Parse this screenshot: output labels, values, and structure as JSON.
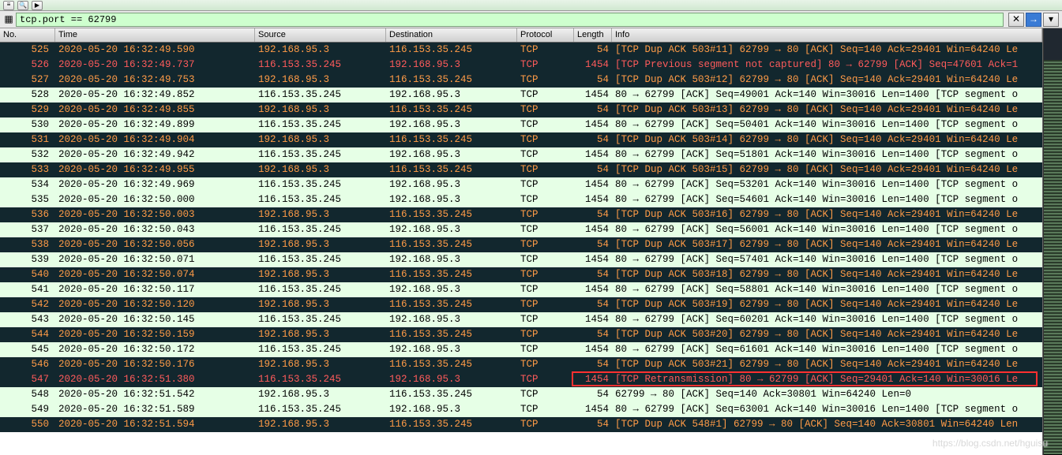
{
  "toolbar": {
    "icons": [
      "≡",
      "🔍",
      "▶"
    ]
  },
  "filter": {
    "icon": "▦",
    "value": "tcp.port == 62799",
    "btn_clear": "✕",
    "btn_apply": "→",
    "btn_dropdown": "▾"
  },
  "columns": {
    "no": "No.",
    "time": "Time",
    "source": "Source",
    "destination": "Destination",
    "protocol": "Protocol",
    "length": "Length",
    "info": "Info"
  },
  "packets": [
    {
      "no": "525",
      "time": "2020-05-20 16:32:49.590",
      "src": "192.168.95.3",
      "dst": "116.153.35.245",
      "proto": "TCP",
      "len": "54",
      "info": "[TCP Dup ACK 503#11] 62799 → 80 [ACK] Seq=140 Ack=29401 Win=64240 Le",
      "cls": "dupack"
    },
    {
      "no": "526",
      "time": "2020-05-20 16:32:49.737",
      "src": "116.153.35.245",
      "dst": "192.168.95.3",
      "proto": "TCP",
      "len": "1454",
      "info": "[TCP Previous segment not captured] 80 → 62799 [ACK] Seq=47601 Ack=1",
      "cls": "notcap"
    },
    {
      "no": "527",
      "time": "2020-05-20 16:32:49.753",
      "src": "192.168.95.3",
      "dst": "116.153.35.245",
      "proto": "TCP",
      "len": "54",
      "info": "[TCP Dup ACK 503#12] 62799 → 80 [ACK] Seq=140 Ack=29401 Win=64240 Le",
      "cls": "dupack"
    },
    {
      "no": "528",
      "time": "2020-05-20 16:32:49.852",
      "src": "116.153.35.245",
      "dst": "192.168.95.3",
      "proto": "TCP",
      "len": "1454",
      "info": "80 → 62799 [ACK] Seq=49001 Ack=140 Win=30016 Len=1400 [TCP segment o",
      "cls": "normal"
    },
    {
      "no": "529",
      "time": "2020-05-20 16:32:49.855",
      "src": "192.168.95.3",
      "dst": "116.153.35.245",
      "proto": "TCP",
      "len": "54",
      "info": "[TCP Dup ACK 503#13] 62799 → 80 [ACK] Seq=140 Ack=29401 Win=64240 Le",
      "cls": "dupack"
    },
    {
      "no": "530",
      "time": "2020-05-20 16:32:49.899",
      "src": "116.153.35.245",
      "dst": "192.168.95.3",
      "proto": "TCP",
      "len": "1454",
      "info": "80 → 62799 [ACK] Seq=50401 Ack=140 Win=30016 Len=1400 [TCP segment o",
      "cls": "normal"
    },
    {
      "no": "531",
      "time": "2020-05-20 16:32:49.904",
      "src": "192.168.95.3",
      "dst": "116.153.35.245",
      "proto": "TCP",
      "len": "54",
      "info": "[TCP Dup ACK 503#14] 62799 → 80 [ACK] Seq=140 Ack=29401 Win=64240 Le",
      "cls": "dupack"
    },
    {
      "no": "532",
      "time": "2020-05-20 16:32:49.942",
      "src": "116.153.35.245",
      "dst": "192.168.95.3",
      "proto": "TCP",
      "len": "1454",
      "info": "80 → 62799 [ACK] Seq=51801 Ack=140 Win=30016 Len=1400 [TCP segment o",
      "cls": "normal"
    },
    {
      "no": "533",
      "time": "2020-05-20 16:32:49.955",
      "src": "192.168.95.3",
      "dst": "116.153.35.245",
      "proto": "TCP",
      "len": "54",
      "info": "[TCP Dup ACK 503#15] 62799 → 80 [ACK] Seq=140 Ack=29401 Win=64240 Le",
      "cls": "dupack"
    },
    {
      "no": "534",
      "time": "2020-05-20 16:32:49.969",
      "src": "116.153.35.245",
      "dst": "192.168.95.3",
      "proto": "TCP",
      "len": "1454",
      "info": "80 → 62799 [ACK] Seq=53201 Ack=140 Win=30016 Len=1400 [TCP segment o",
      "cls": "normal"
    },
    {
      "no": "535",
      "time": "2020-05-20 16:32:50.000",
      "src": "116.153.35.245",
      "dst": "192.168.95.3",
      "proto": "TCP",
      "len": "1454",
      "info": "80 → 62799 [ACK] Seq=54601 Ack=140 Win=30016 Len=1400 [TCP segment o",
      "cls": "normal"
    },
    {
      "no": "536",
      "time": "2020-05-20 16:32:50.003",
      "src": "192.168.95.3",
      "dst": "116.153.35.245",
      "proto": "TCP",
      "len": "54",
      "info": "[TCP Dup ACK 503#16] 62799 → 80 [ACK] Seq=140 Ack=29401 Win=64240 Le",
      "cls": "dupack"
    },
    {
      "no": "537",
      "time": "2020-05-20 16:32:50.043",
      "src": "116.153.35.245",
      "dst": "192.168.95.3",
      "proto": "TCP",
      "len": "1454",
      "info": "80 → 62799 [ACK] Seq=56001 Ack=140 Win=30016 Len=1400 [TCP segment o",
      "cls": "normal"
    },
    {
      "no": "538",
      "time": "2020-05-20 16:32:50.056",
      "src": "192.168.95.3",
      "dst": "116.153.35.245",
      "proto": "TCP",
      "len": "54",
      "info": "[TCP Dup ACK 503#17] 62799 → 80 [ACK] Seq=140 Ack=29401 Win=64240 Le",
      "cls": "dupack"
    },
    {
      "no": "539",
      "time": "2020-05-20 16:32:50.071",
      "src": "116.153.35.245",
      "dst": "192.168.95.3",
      "proto": "TCP",
      "len": "1454",
      "info": "80 → 62799 [ACK] Seq=57401 Ack=140 Win=30016 Len=1400 [TCP segment o",
      "cls": "normal"
    },
    {
      "no": "540",
      "time": "2020-05-20 16:32:50.074",
      "src": "192.168.95.3",
      "dst": "116.153.35.245",
      "proto": "TCP",
      "len": "54",
      "info": "[TCP Dup ACK 503#18] 62799 → 80 [ACK] Seq=140 Ack=29401 Win=64240 Le",
      "cls": "dupack"
    },
    {
      "no": "541",
      "time": "2020-05-20 16:32:50.117",
      "src": "116.153.35.245",
      "dst": "192.168.95.3",
      "proto": "TCP",
      "len": "1454",
      "info": "80 → 62799 [ACK] Seq=58801 Ack=140 Win=30016 Len=1400 [TCP segment o",
      "cls": "normal"
    },
    {
      "no": "542",
      "time": "2020-05-20 16:32:50.120",
      "src": "192.168.95.3",
      "dst": "116.153.35.245",
      "proto": "TCP",
      "len": "54",
      "info": "[TCP Dup ACK 503#19] 62799 → 80 [ACK] Seq=140 Ack=29401 Win=64240 Le",
      "cls": "dupack"
    },
    {
      "no": "543",
      "time": "2020-05-20 16:32:50.145",
      "src": "116.153.35.245",
      "dst": "192.168.95.3",
      "proto": "TCP",
      "len": "1454",
      "info": "80 → 62799 [ACK] Seq=60201 Ack=140 Win=30016 Len=1400 [TCP segment o",
      "cls": "normal"
    },
    {
      "no": "544",
      "time": "2020-05-20 16:32:50.159",
      "src": "192.168.95.3",
      "dst": "116.153.35.245",
      "proto": "TCP",
      "len": "54",
      "info": "[TCP Dup ACK 503#20] 62799 → 80 [ACK] Seq=140 Ack=29401 Win=64240 Le",
      "cls": "dupack"
    },
    {
      "no": "545",
      "time": "2020-05-20 16:32:50.172",
      "src": "116.153.35.245",
      "dst": "192.168.95.3",
      "proto": "TCP",
      "len": "1454",
      "info": "80 → 62799 [ACK] Seq=61601 Ack=140 Win=30016 Len=1400 [TCP segment o",
      "cls": "normal"
    },
    {
      "no": "546",
      "time": "2020-05-20 16:32:50.176",
      "src": "192.168.95.3",
      "dst": "116.153.35.245",
      "proto": "TCP",
      "len": "54",
      "info": "[TCP Dup ACK 503#21] 62799 → 80 [ACK] Seq=140 Ack=29401 Win=64240 Le",
      "cls": "dupack"
    },
    {
      "no": "547",
      "time": "2020-05-20 16:32:51.380",
      "src": "116.153.35.245",
      "dst": "192.168.95.3",
      "proto": "TCP",
      "len": "1454",
      "info": "[TCP Retransmission] 80 → 62799 [ACK] Seq=29401 Ack=140 Win=30016 Le",
      "cls": "retrans",
      "highlight": true
    },
    {
      "no": "548",
      "time": "2020-05-20 16:32:51.542",
      "src": "192.168.95.3",
      "dst": "116.153.35.245",
      "proto": "TCP",
      "len": "54",
      "info": "62799 → 80 [ACK] Seq=140 Ack=30801 Win=64240 Len=0",
      "cls": "normal"
    },
    {
      "no": "549",
      "time": "2020-05-20 16:32:51.589",
      "src": "116.153.35.245",
      "dst": "192.168.95.3",
      "proto": "TCP",
      "len": "1454",
      "info": "80 → 62799 [ACK] Seq=63001 Ack=140 Win=30016 Len=1400 [TCP segment o",
      "cls": "normal"
    },
    {
      "no": "550",
      "time": "2020-05-20 16:32:51.594",
      "src": "192.168.95.3",
      "dst": "116.153.35.245",
      "proto": "TCP",
      "len": "54",
      "info": "[TCP Dup ACK 548#1] 62799 → 80 [ACK] Seq=140 Ack=30801 Win=64240 Len",
      "cls": "dupack"
    }
  ],
  "watermark": "https://blog.csdn.net/hguisu"
}
